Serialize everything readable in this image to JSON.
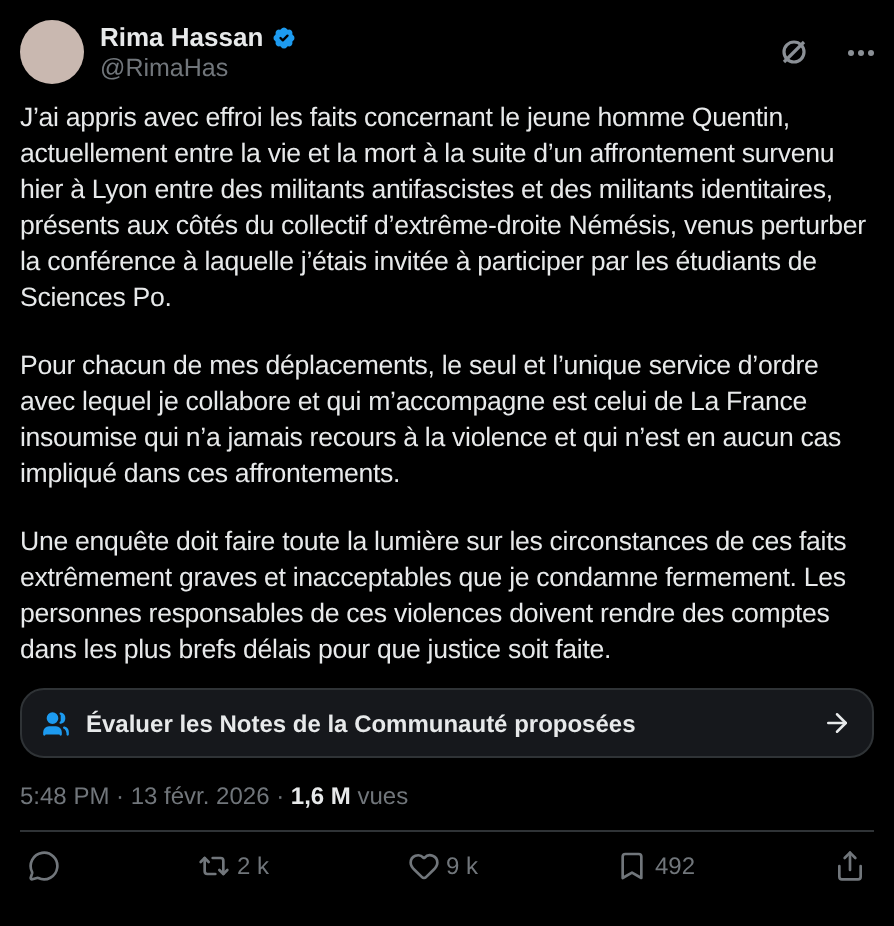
{
  "author": {
    "name": "Rima Hassan",
    "handle": "@RimaHas",
    "verified": true
  },
  "paragraphs": [
    "J’ai appris avec effroi les faits concernant le jeune homme Quentin, actuellement entre la vie et la mort à la suite d’un affrontement survenu hier à Lyon entre des militants antifascistes et des militants identitaires, présents aux côtés du collectif d’extrême-droite Némésis, venus perturber la conférence à laquelle j’étais invitée à participer par les étudiants de Sciences Po.",
    "Pour chacun de mes déplacements, le seul et l’unique service d’ordre avec lequel je collabore et qui m’accompagne est celui de La France insoumise qui n’a jamais recours à la violence et qui n’est en aucun cas impliqué dans ces affrontements.",
    "Une enquête doit faire toute la lumière sur les circonstances de ces faits extrêmement  graves et inacceptables que je condamne fermement. Les personnes responsables de ces violences doivent rendre des comptes dans les plus brefs délais pour que justice soit faite."
  ],
  "community_notes": {
    "label": "Évaluer les Notes de la Communauté proposées"
  },
  "meta": "5:48 PM · 13 févr. 2026 · **1,6 M** vues",
  "actions": [
    {
      "kind": "reply"
    },
    {
      "kind": "repost",
      "count": "2 k"
    },
    {
      "kind": "like",
      "count": "9 k"
    },
    {
      "kind": "bookmark",
      "count": "492"
    },
    {
      "kind": "share"
    }
  ]
}
